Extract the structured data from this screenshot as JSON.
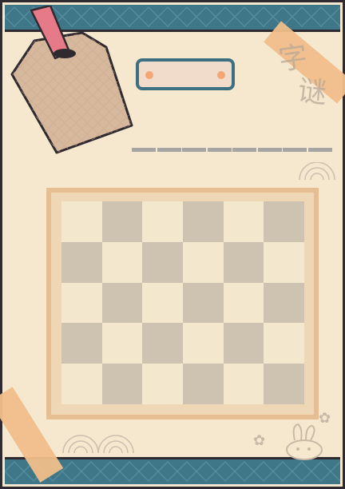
{
  "title_plaque": {
    "text": ""
  },
  "logo": {
    "glyphs": [
      "字",
      "谜"
    ]
  },
  "answer_slots": {
    "count": 8
  },
  "board": {
    "rows": 5,
    "cols": 6,
    "pattern": [
      [
        "light",
        "dark",
        "light",
        "dark",
        "light",
        "dark"
      ],
      [
        "dark",
        "light",
        "dark",
        "light",
        "dark",
        "light"
      ],
      [
        "light",
        "dark",
        "light",
        "dark",
        "light",
        "dark"
      ],
      [
        "dark",
        "light",
        "dark",
        "light",
        "dark",
        "light"
      ],
      [
        "light",
        "dark",
        "light",
        "dark",
        "light",
        "dark"
      ]
    ]
  },
  "colors": {
    "paper": "#f5e8cf",
    "band": "#3f7688",
    "tag": "#d6b89c",
    "ribbon": "#e77a88",
    "board_frame": "#e7bd92",
    "cell_dark": "#cec3b1",
    "cell_light": "#f3e7ce",
    "accent": "#f2a774"
  }
}
